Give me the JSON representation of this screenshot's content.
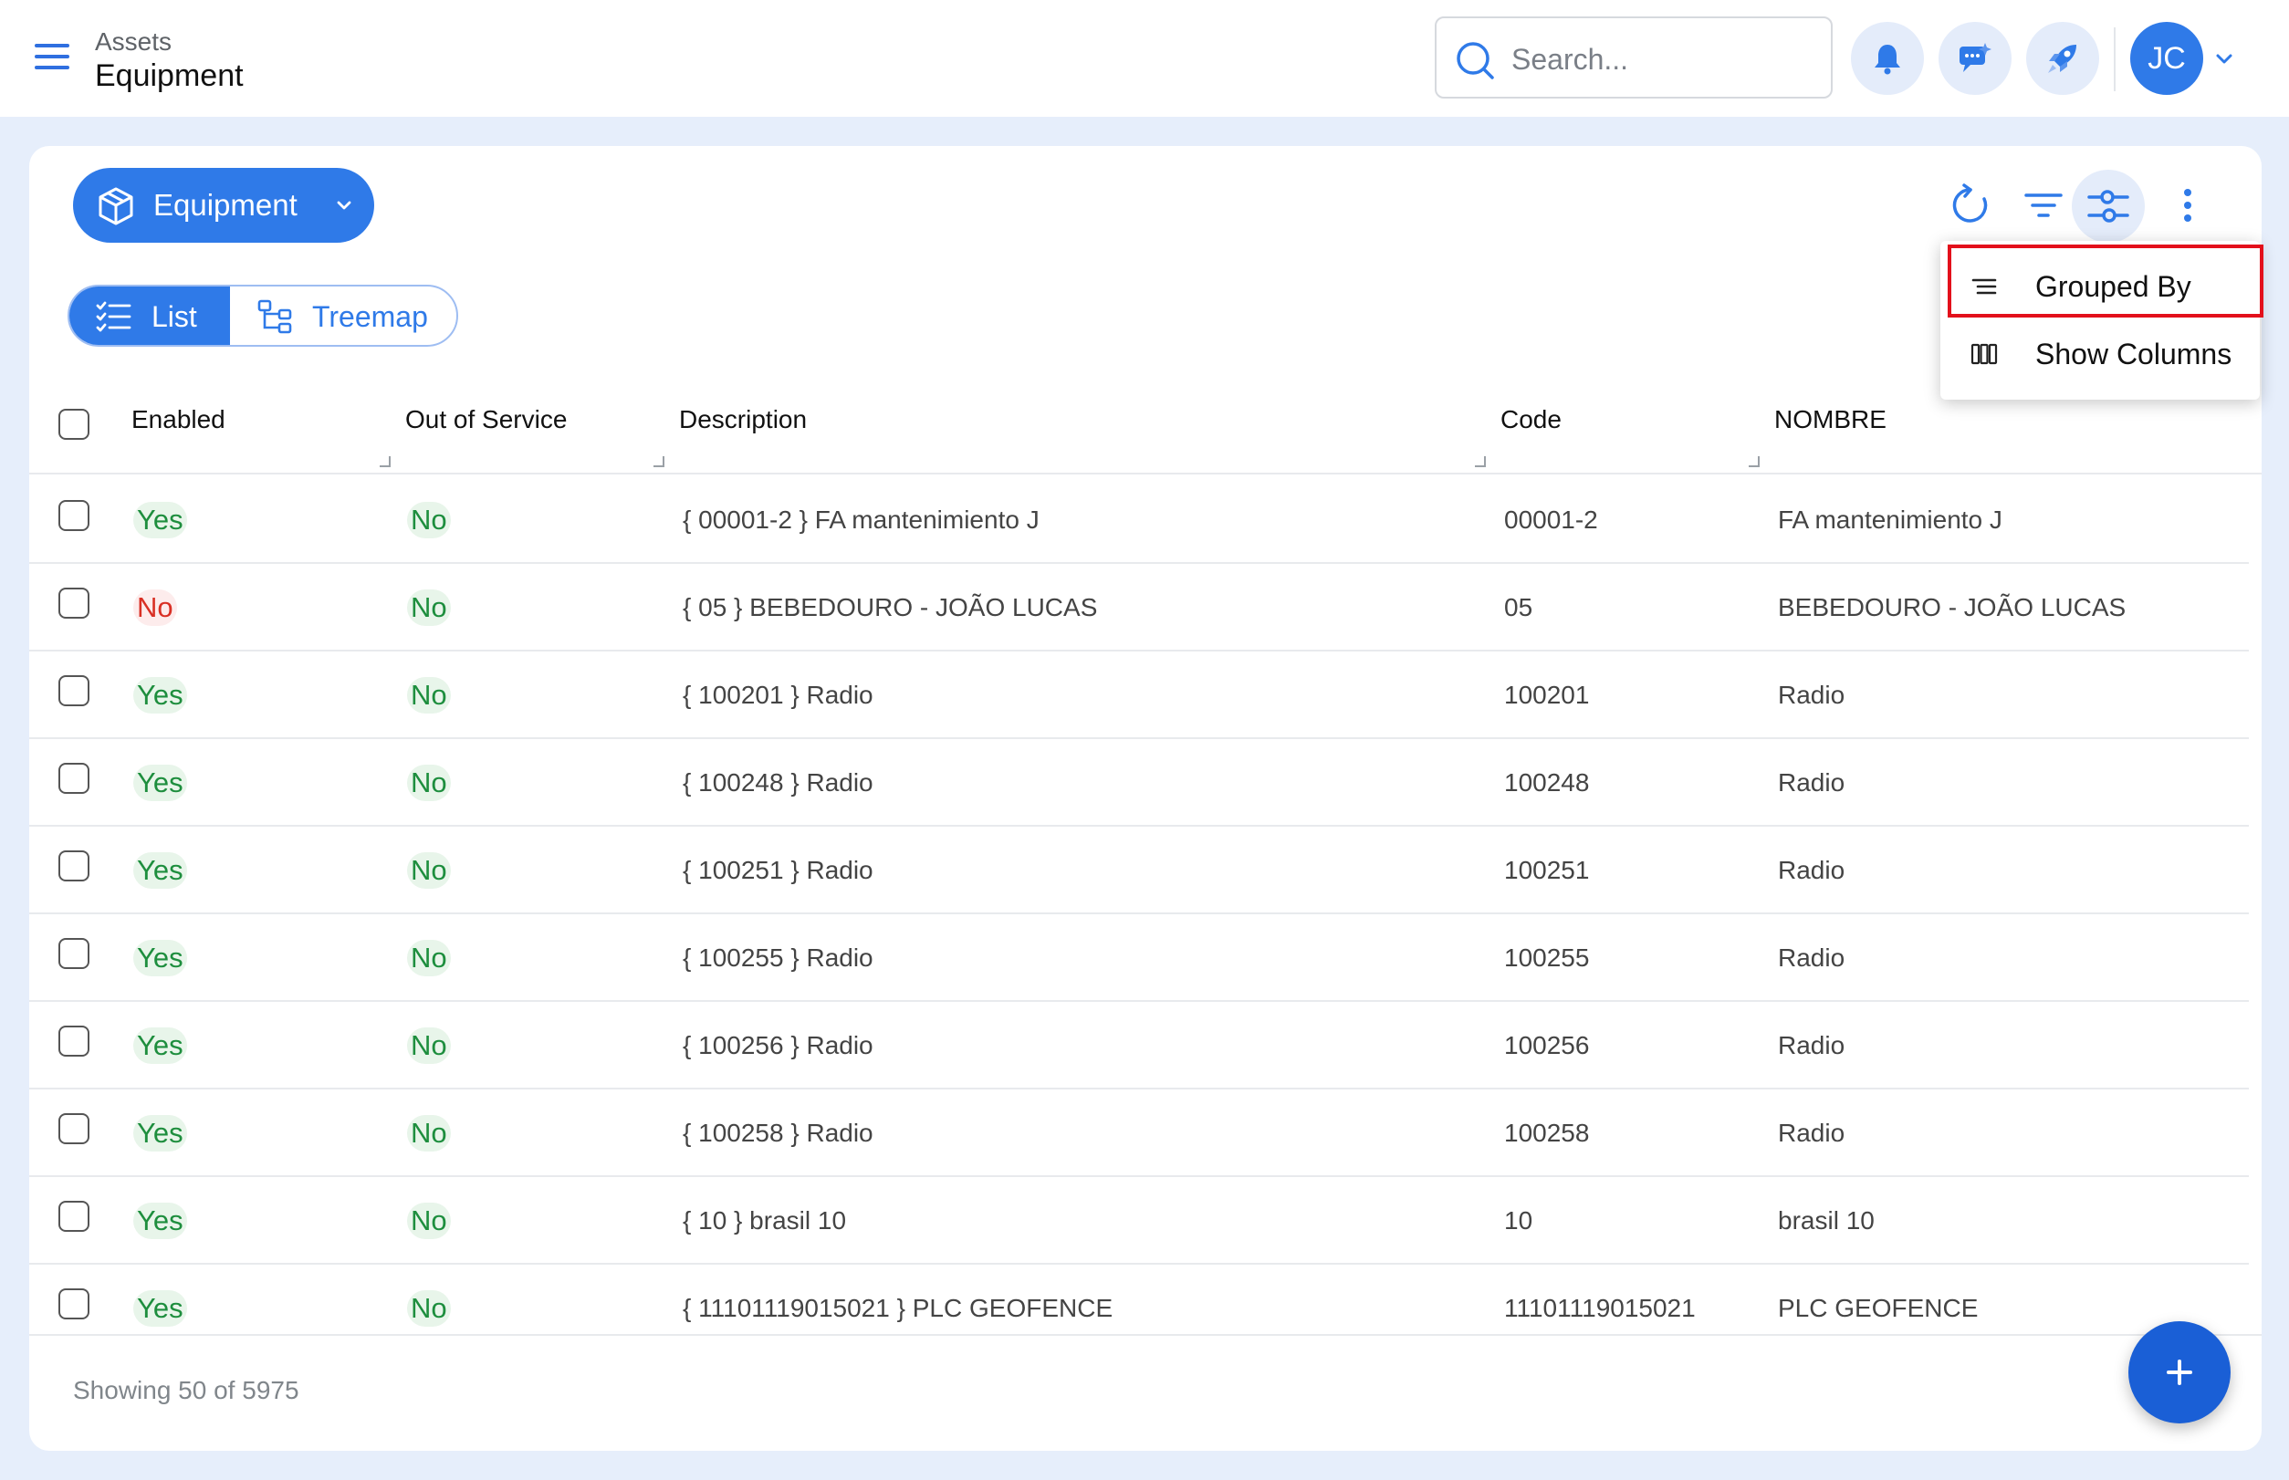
{
  "header": {
    "breadcrumb_parent": "Assets",
    "breadcrumb_current": "Equipment",
    "search_placeholder": "Search...",
    "user_initials": "JC"
  },
  "toolbar": {
    "module_label": "Equipment",
    "view_list_label": "List",
    "view_treemap_label": "Treemap"
  },
  "table": {
    "columns": [
      "Enabled",
      "Out of Service",
      "Description",
      "Code",
      "NOMBRE"
    ],
    "rows": [
      {
        "enabled": "Yes",
        "out_of_service": "No",
        "description": "{ 00001-2 } FA mantenimiento J",
        "code": "00001-2",
        "nombre": "FA mantenimiento J"
      },
      {
        "enabled": "No",
        "out_of_service": "No",
        "description": "{ 05 } BEBEDOURO - JOÃO LUCAS",
        "code": "05",
        "nombre": "BEBEDOURO - JOÃO LUCAS"
      },
      {
        "enabled": "Yes",
        "out_of_service": "No",
        "description": "{ 100201 } Radio",
        "code": "100201",
        "nombre": "Radio"
      },
      {
        "enabled": "Yes",
        "out_of_service": "No",
        "description": "{ 100248 } Radio",
        "code": "100248",
        "nombre": "Radio"
      },
      {
        "enabled": "Yes",
        "out_of_service": "No",
        "description": "{ 100251 } Radio",
        "code": "100251",
        "nombre": "Radio"
      },
      {
        "enabled": "Yes",
        "out_of_service": "No",
        "description": "{ 100255 } Radio",
        "code": "100255",
        "nombre": "Radio"
      },
      {
        "enabled": "Yes",
        "out_of_service": "No",
        "description": "{ 100256 } Radio",
        "code": "100256",
        "nombre": "Radio"
      },
      {
        "enabled": "Yes",
        "out_of_service": "No",
        "description": "{ 100258 } Radio",
        "code": "100258",
        "nombre": "Radio"
      },
      {
        "enabled": "Yes",
        "out_of_service": "No",
        "description": "{ 10 } brasil 10",
        "code": "10",
        "nombre": "brasil 10"
      },
      {
        "enabled": "Yes",
        "out_of_service": "No",
        "description": "{ 11101119015021 } PLC GEOFENCE",
        "code": "11101119015021",
        "nombre": "PLC GEOFENCE"
      }
    ]
  },
  "footer": {
    "showing_text": "Showing 50 of 5975"
  },
  "menu": {
    "items": [
      "Grouped By",
      "Show Columns"
    ]
  },
  "colors": {
    "accent": "#2f7ae8",
    "background": "#e6eefb",
    "yes_green": "#1e8e3e",
    "no_red": "#d93025",
    "highlight_border": "#e3101b"
  }
}
